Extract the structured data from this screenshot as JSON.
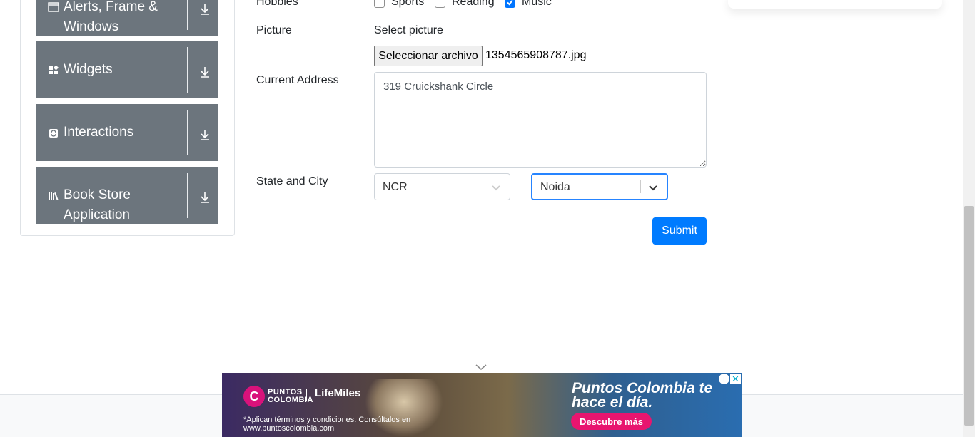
{
  "sidebar": {
    "groups": [
      {
        "label": "Alerts, Frame & Windows",
        "icon": "window-icon"
      },
      {
        "label": "Widgets",
        "icon": "widgets-icon"
      },
      {
        "label": "Interactions",
        "icon": "interactions-icon"
      },
      {
        "label": "Book Store Application",
        "icon": "book-store-icon"
      }
    ]
  },
  "form": {
    "hobbies_label": "Hobbies",
    "hobbies": [
      {
        "label": "Sports",
        "checked": false
      },
      {
        "label": "Reading",
        "checked": false
      },
      {
        "label": "Music",
        "checked": true
      }
    ],
    "picture_label": "Picture",
    "select_picture": "Select picture",
    "file_button": "Seleccionar archivo",
    "file_name": "1354565908787.jpg",
    "address_label": "Current Address",
    "address_value": "319 Cruickshank Circle",
    "state_city_label": "State and City",
    "state_value": "NCR",
    "city_value": "Noida",
    "submit_label": "Submit"
  },
  "ad": {
    "brand": "PUNTOS COLOMBIA",
    "partner": "LifeMiles",
    "disclaimer": "*Aplican términos y condiciones. Consúltalos en www.puntoscolombia.com",
    "headline": "Puntos Colombia te hace el día.",
    "cta": "Descubre más",
    "logo_letter": "C"
  },
  "colors": {
    "sidebar_group_bg": "#6c757d",
    "primary": "#007bff",
    "focus": "#2684ff",
    "ad_cta": "#e8156f"
  }
}
